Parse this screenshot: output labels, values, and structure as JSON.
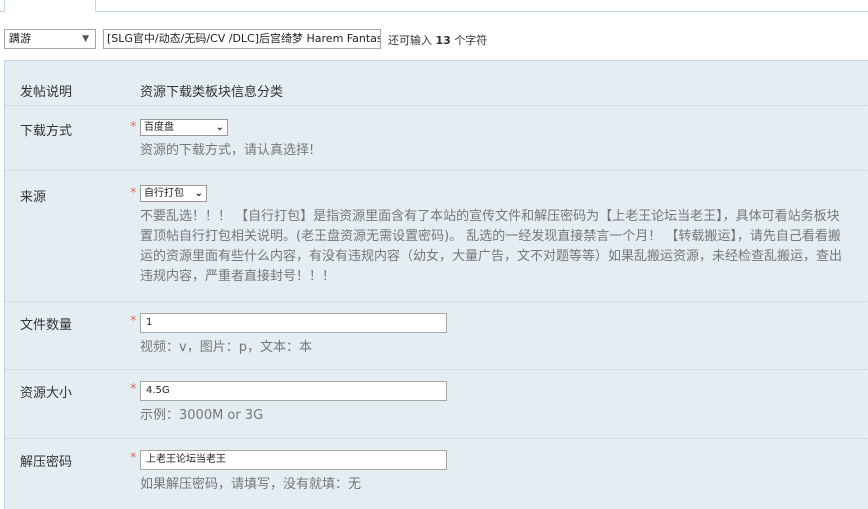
{
  "type_select": {
    "value": "蹒游"
  },
  "title_input": {
    "value": "[SLG官中/动态/无码/CV /DLC]后宫绮梦 Harem Fantasy v"
  },
  "char_hint": {
    "prefix": "还可输入",
    "count": "13",
    "suffix": "个字符"
  },
  "rows": {
    "intro": {
      "label": "发帖说明",
      "value": "资源下载类板块信息分类"
    },
    "download": {
      "label": "下载方式",
      "required": "*",
      "selected": "百度盘",
      "hint": "资源的下载方式，请认真选择!"
    },
    "source": {
      "label": "来源",
      "required": "*",
      "selected": "自行打包",
      "hint_lines": [
        "不要乱选！！！ 【自行打包】是指资源里面含有了本站的宣传文件和解压密码为【上老王论坛当老王】，具体可看站务板块",
        "置顶帖自行打包相关说明。(老王盘资源无需设置密码)。 乱选的一经发现直接禁言一个月！ 【转载搬运】，请先自己看看搬",
        "运的资源里面有些什么内容，有没有违规内容（幼女，大量广告，文不对题等等）如果乱搬运资源，未经检查乱搬运，查出",
        "违规内容，严重者直接封号！！！"
      ]
    },
    "file_count": {
      "label": "文件数量",
      "required": "*",
      "value": "1",
      "hint": "视频：v，图片：p，文本：本"
    },
    "size": {
      "label": "资源大小",
      "required": "*",
      "value": "4.5G",
      "hint": "示例：3000M or 3G"
    },
    "password": {
      "label": "解压密码",
      "required": "*",
      "value": "上老王论坛当老王",
      "hint": "如果解压密码，请填写，没有就填：无"
    }
  }
}
